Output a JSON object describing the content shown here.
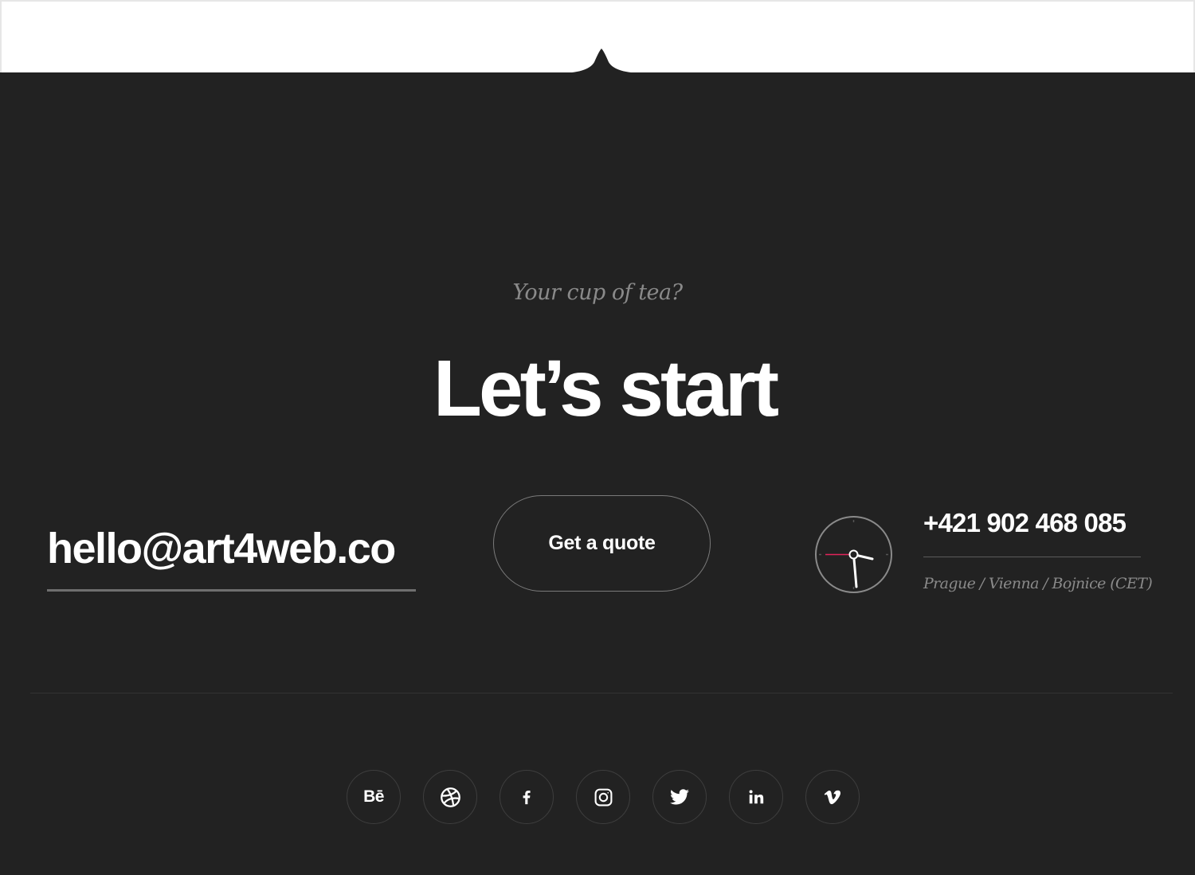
{
  "contact": {
    "tagline": "Your cup of tea?",
    "headline": "Let’s start",
    "email": "hello@art4web.co",
    "quote_button_label": "Get a quote",
    "phone": "+421 902 468 085",
    "locations": "Prague / Vienna / Bojnice (CET)"
  },
  "social": {
    "behance_label": "Bē",
    "icons": [
      "behance-icon",
      "dribbble-icon",
      "facebook-icon",
      "instagram-icon",
      "twitter-icon",
      "linkedin-icon",
      "vimeo-icon"
    ]
  },
  "colors": {
    "background": "#222222",
    "text": "#ffffff",
    "muted_text": "#8a8a8a",
    "clock_second_hand": "#e2245b"
  }
}
